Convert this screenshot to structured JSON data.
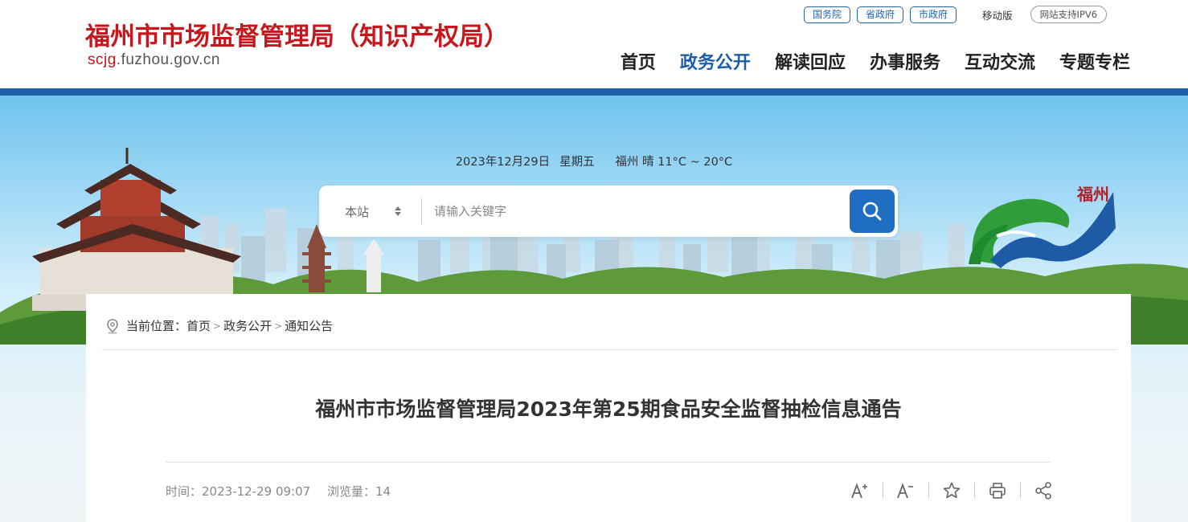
{
  "header": {
    "title": "福州市市场监督管理局（知识产权局）",
    "domain_red": "scjg",
    "domain_rest": ".fuzhou.gov.cn",
    "top_links": [
      "国务院",
      "省政府",
      "市政府"
    ],
    "mobile": "移动版",
    "ipv6": "网站支持IPV6",
    "nav": [
      {
        "label": "首页",
        "active": false
      },
      {
        "label": "政务公开",
        "active": true
      },
      {
        "label": "解读回应",
        "active": false
      },
      {
        "label": "办事服务",
        "active": false
      },
      {
        "label": "互动交流",
        "active": false
      },
      {
        "label": "专题专栏",
        "active": false
      }
    ]
  },
  "banner": {
    "date": "2023年12月29日",
    "weekday": "星期五",
    "weather": "福州 晴 11°C ~ 20°C",
    "emblem_text": "福州"
  },
  "search": {
    "scope": "本站",
    "placeholder": "请输入关键字"
  },
  "breadcrumb": {
    "prefix": "当前位置：",
    "items": [
      "首页",
      "政务公开",
      "通知公告"
    ]
  },
  "article": {
    "title": "福州市市场监督管理局2023年第25期食品安全监督抽检信息通告",
    "time_label": "时间：2023-12-29 09:07",
    "views_label": "浏览量：14"
  },
  "colors": {
    "brand_red": "#c8161d",
    "brand_blue": "#1f5fa7",
    "nav_active": "#1c5fa8",
    "search_button": "#1f6ec3"
  },
  "icons": [
    "search-icon",
    "location-icon",
    "font-increase-icon",
    "font-decrease-icon",
    "star-icon",
    "print-icon",
    "share-icon"
  ]
}
